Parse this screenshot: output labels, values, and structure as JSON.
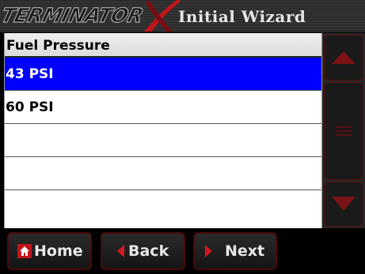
{
  "titlebar": {
    "logo_text": "TERMINATOR",
    "logo_mark": "X",
    "title": "Initial Wizard"
  },
  "list": {
    "header": "Fuel Pressure",
    "items": [
      "43 PSI",
      "60 PSI",
      "",
      "",
      ""
    ],
    "selected_index": 0
  },
  "scrollbar": {
    "up_icon": "triangle-up-icon",
    "thumb_icon": "grip-lines-icon",
    "down_icon": "triangle-down-icon"
  },
  "buttons": {
    "home": "Home",
    "back": "Back",
    "next": "Next"
  },
  "colors": {
    "selection": "#0000ff",
    "accent_red": "#c0161b",
    "title_text": "#e6e6e6"
  }
}
